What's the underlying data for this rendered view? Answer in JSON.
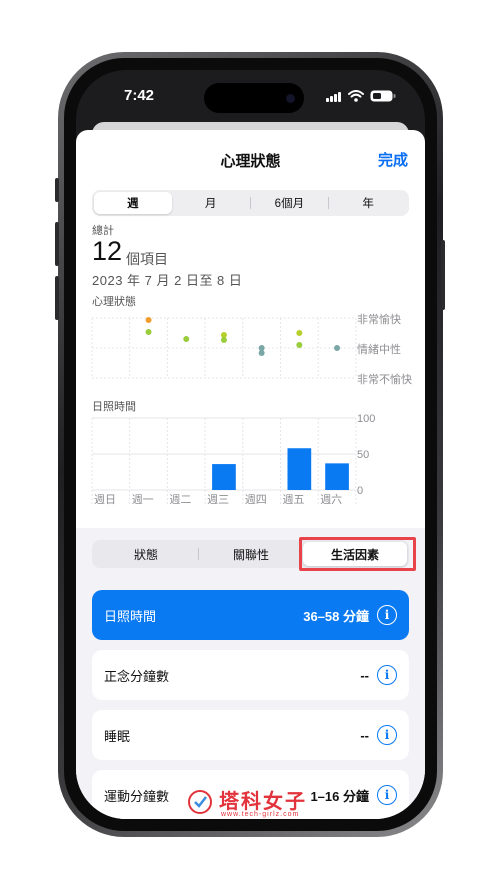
{
  "status_bar": {
    "time": "7:42"
  },
  "header": {
    "title": "心理狀態",
    "done_label": "完成"
  },
  "range_tabs": [
    "週",
    "月",
    "6個月",
    "年"
  ],
  "range_selected": "週",
  "summary": {
    "label": "總計",
    "count": "12",
    "unit": "個項目",
    "date_range": "2023 年 7 月 2 日至 8 日"
  },
  "mood_chart": {
    "title": "心理狀態",
    "levels": [
      "非常愉快",
      "情緒中性",
      "非常不愉快"
    ]
  },
  "chart_data": {
    "type": "bar",
    "title": "日照時間",
    "categories": [
      "週日",
      "週一",
      "週二",
      "週三",
      "週四",
      "週五",
      "週六"
    ],
    "y_ticks": [
      "100",
      "50",
      "0"
    ],
    "ylim": [
      0,
      100
    ],
    "values": [
      0,
      0,
      0,
      36,
      0,
      58,
      37
    ],
    "bar_color": "#0a7af2"
  },
  "factor_tabs": [
    "狀態",
    "關聯性",
    "生活因素"
  ],
  "factor_selected": "生活因素",
  "factors": [
    {
      "label": "日照時間",
      "value": "36–58 分鐘",
      "selected": true
    },
    {
      "label": "正念分鐘數",
      "value": "--",
      "selected": false
    },
    {
      "label": "睡眠",
      "value": "--",
      "selected": false
    },
    {
      "label": "運動分鐘數",
      "value": "1–16 分鐘",
      "selected": false
    }
  ],
  "watermark": {
    "text": "塔科女子",
    "sub": "www.tech-girlz.com"
  },
  "colors": {
    "accent": "#0a7af2",
    "highlight": "#e8434b"
  }
}
